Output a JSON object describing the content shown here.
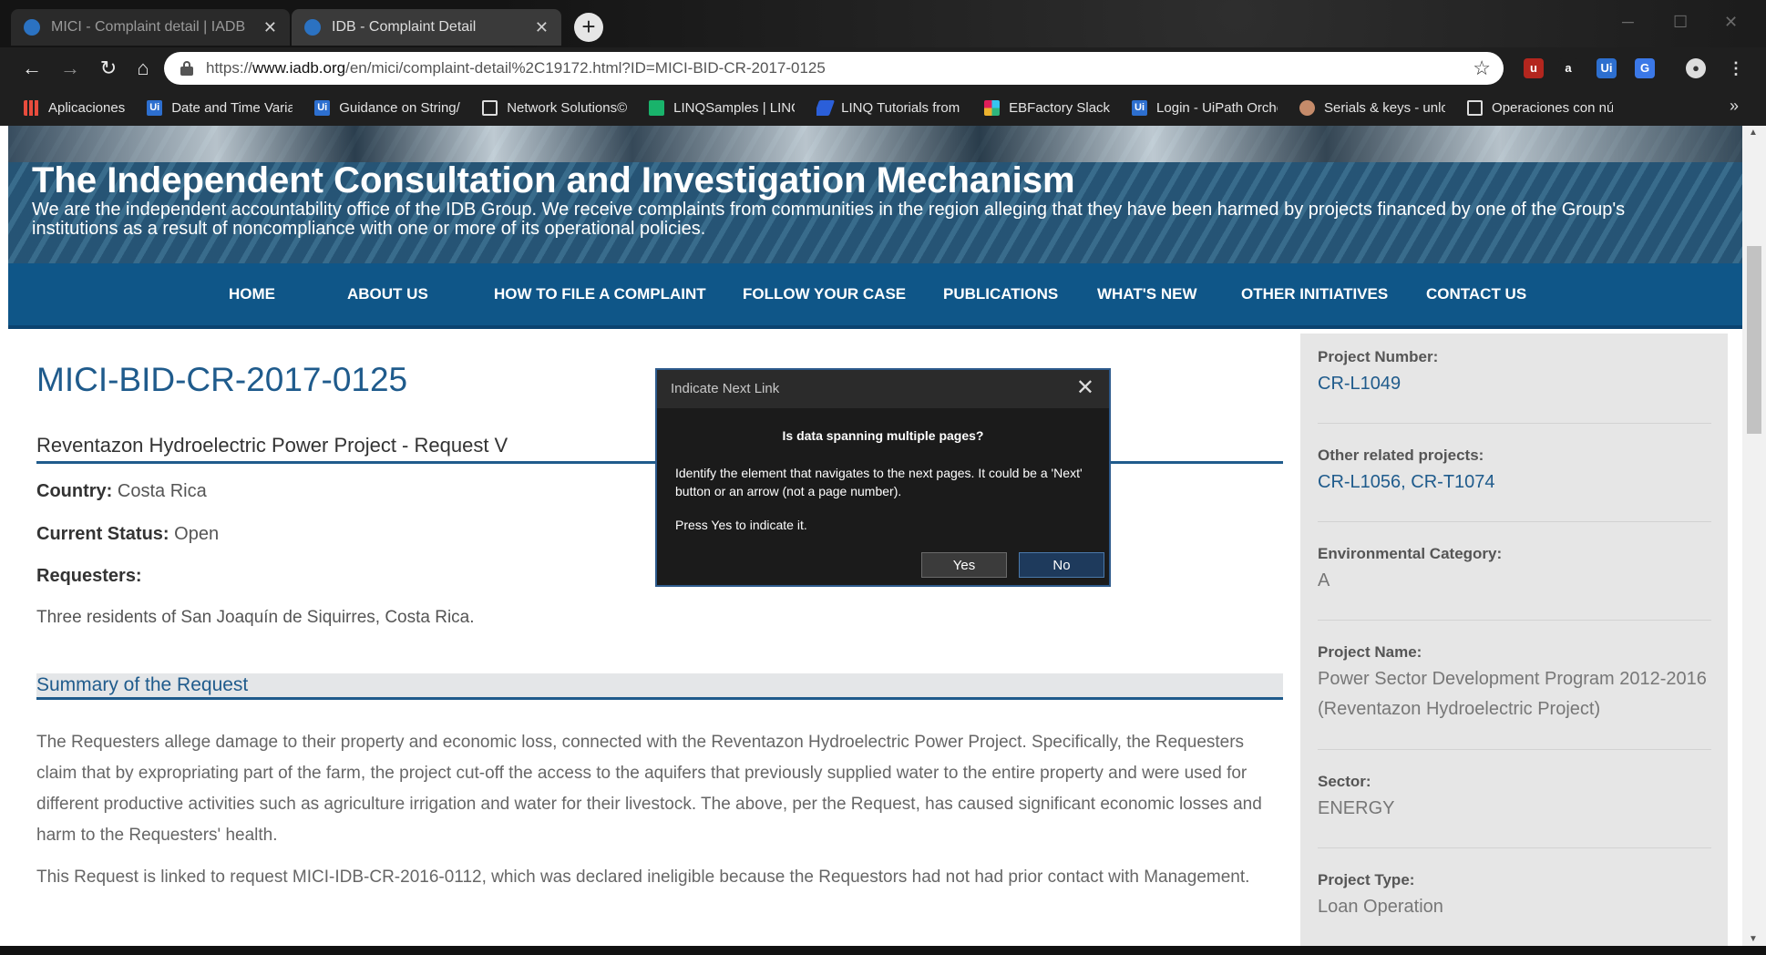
{
  "browser": {
    "tabs": [
      {
        "title": "MICI - Complaint detail | IADB",
        "active": false
      },
      {
        "title": "IDB - Complaint Detail",
        "active": true
      }
    ],
    "url_prefix": "https://",
    "url_host": "www.iadb.org",
    "url_path": "/en/mici/complaint-detail%2C19172.html?ID=MICI-BID-CR-2017-0125",
    "new_tab_label": "+",
    "bookmarks": [
      {
        "label": "Aplicaciones",
        "icon": "apps-grid-icon"
      },
      {
        "label": "Date and Time Variab",
        "icon": "uipath-icon"
      },
      {
        "label": "Guidance on String/D",
        "icon": "uipath-icon"
      },
      {
        "label": "Network Solutions©",
        "icon": "file-icon"
      },
      {
        "label": "LINQSamples | LINQ",
        "icon": "linq-icon"
      },
      {
        "label": "LINQ Tutorials from :",
        "icon": "tutorial-icon"
      },
      {
        "label": "EBFactory Slack",
        "icon": "slack-icon"
      },
      {
        "label": "Login - UiPath Orche",
        "icon": "uipath-icon"
      },
      {
        "label": "Serials & keys - unlo",
        "icon": "keys-icon"
      },
      {
        "label": "Operaciones con nún",
        "icon": "file-icon"
      }
    ],
    "more_bookmarks": "»"
  },
  "banner": {
    "title": "The Independent Consultation and Investigation Mechanism",
    "subtitle": "We are the independent accountability office of the IDB Group. We receive complaints from communities in the region alleging that they have been harmed by projects financed by one of the Group's institutions as a result of noncompliance with one or more of its operational policies."
  },
  "nav": {
    "items": [
      "HOME",
      "ABOUT US",
      "HOW TO FILE A COMPLAINT",
      "FOLLOW YOUR CASE",
      "PUBLICATIONS",
      "WHAT'S NEW",
      "OTHER INITIATIVES",
      "CONTACT US"
    ]
  },
  "main": {
    "case_id": "MICI-BID-CR-2017-0125",
    "request_title": "Reventazon Hydroelectric Power Project - Request V",
    "country_label": "Country:",
    "country_value": "Costa Rica",
    "status_label": "Current Status:",
    "status_value": "Open",
    "requesters_label": "Requesters:",
    "requesters_value": "Three residents of San Joaquín de Siquirres, Costa Rica.",
    "summary_title": "Summary of the Request",
    "paragraphs": [
      "The Requesters allege damage to their property and economic loss, connected with the Reventazon Hydroelectric Power Project. Specifically, the Requesters claim that by expropriating part of the farm, the project cut-off the access to the aquifers that previously supplied water to the entire property and were used for different productive activities such as agriculture irrigation and water for their livestock. The above, per the Request, has caused significant economic losses and harm to the Requesters' health.",
      "This Request is linked to request MICI-IDB-CR-2016-0112, which was declared ineligible because the Requestors had not had prior contact with Management."
    ]
  },
  "sidebar": {
    "project_number_label": "Project Number:",
    "project_number": "CR-L1049",
    "related_label": "Other related projects:",
    "related": "CR-L1056, CR-T1074",
    "env_category_label": "Environmental Category:",
    "env_category": "A",
    "project_name_label": "Project Name:",
    "project_name": "Power Sector Development Program 2012-2016 (Reventazon Hydroelectric Project)",
    "sector_label": "Sector:",
    "sector": "ENERGY",
    "project_type_label": "Project Type:",
    "project_type": "Loan Operation"
  },
  "dialog": {
    "title": "Indicate Next Link",
    "question": "Is data spanning multiple pages?",
    "description": "Identify the element that navigates to the next pages. It could be a 'Next' button or an arrow (not a page number).",
    "hint": "Press Yes to indicate it.",
    "yes_label": "Yes",
    "no_label": "No",
    "close_glyph": "✕"
  },
  "colors": {
    "nav_blue": "#0f5688",
    "link_blue": "#1f5b8c",
    "dialog_bg": "#1b1b1b"
  }
}
